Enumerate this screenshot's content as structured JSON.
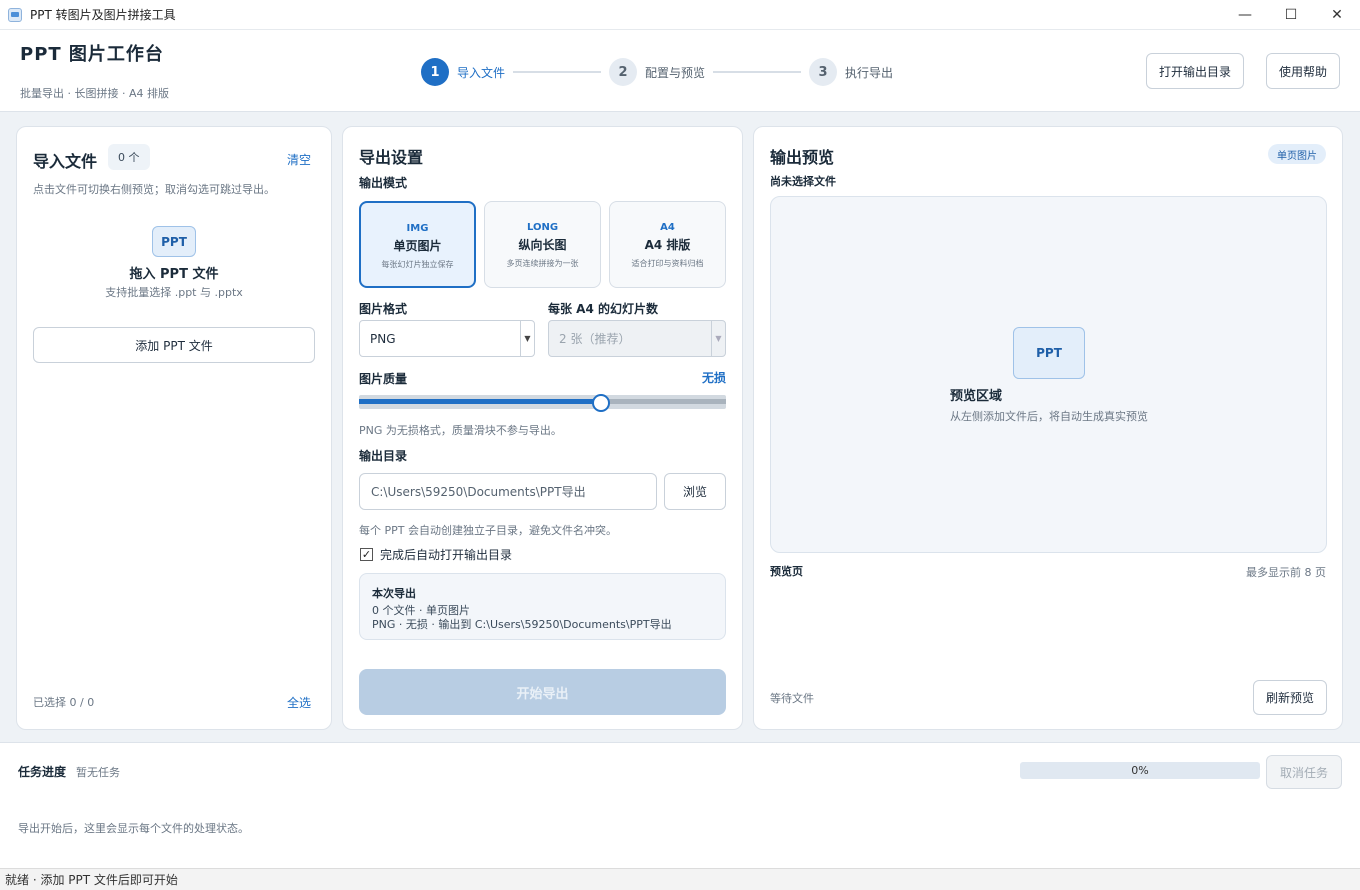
{
  "window": {
    "title": "PPT 转图片及图片拼接工具",
    "minimize": "—",
    "maximize": "☐",
    "close": "✕"
  },
  "header": {
    "title": "PPT 图片工作台",
    "subtitle": "批量导出 · 长图拼接 · A4 排版",
    "steps": [
      {
        "num": "1",
        "label": "导入文件",
        "active": true
      },
      {
        "num": "2",
        "label": "配置与预览",
        "active": false
      },
      {
        "num": "3",
        "label": "执行导出",
        "active": false
      }
    ],
    "open_output_dir": "打开输出目录",
    "help": "使用帮助"
  },
  "import_panel": {
    "title": "导入文件",
    "count_badge": "0 个",
    "clear": "清空",
    "hint": "点击文件可切换右侧预览；取消勾选可跳过导出。",
    "drop_chip": "PPT",
    "drop_title": "拖入 PPT 文件",
    "drop_sub": "支持批量选择 .ppt 与 .pptx",
    "add_button": "添加 PPT 文件",
    "selected_info": "已选择 0 / 0",
    "select_all": "全选"
  },
  "export_settings": {
    "title": "导出设置",
    "mode_label": "输出模式",
    "modes": [
      {
        "tag": "IMG",
        "name": "单页图片",
        "desc": "每张幻灯片独立保存",
        "selected": true
      },
      {
        "tag": "LONG",
        "name": "纵向长图",
        "desc": "多页连续拼接为一张",
        "selected": false
      },
      {
        "tag": "A4",
        "name": "A4 排版",
        "desc": "适合打印与资料归档",
        "selected": false
      }
    ],
    "format_label": "图片格式",
    "format_value": "PNG",
    "per_a4_label": "每张 A4 的幻灯片数",
    "per_a4_value": "2 张（推荐）",
    "quality_label": "图片质量",
    "quality_value": "无损",
    "quality_level": 0.66,
    "quality_note": "PNG 为无损格式，质量滑块不参与导出。",
    "output_dir_label": "输出目录",
    "output_dir_value": "C:\\Users\\59250\\Documents\\PPT导出",
    "browse": "浏览",
    "output_dir_note": "每个 PPT 会自动创建独立子目录，避免文件名冲突。",
    "auto_open_checked": "✓",
    "auto_open_label": "完成后自动打开输出目录",
    "summary_title": "本次导出",
    "summary_line1": "0 个文件 · 单页图片",
    "summary_line2": "PNG · 无损 · 输出到 C:\\Users\\59250\\Documents\\PPT导出",
    "start_button": "开始导出"
  },
  "preview_panel": {
    "title": "输出预览",
    "mode_pill": "单页图片",
    "file_status": "尚未选择文件",
    "chip": "PPT",
    "area_title": "预览区域",
    "area_sub": "从左侧添加文件后，将自动生成真实预览",
    "pages_label": "预览页",
    "pages_limit": "最多显示前 8 页",
    "waiting": "等待文件",
    "refresh": "刷新预览"
  },
  "task": {
    "title": "任务进度",
    "status": "暂无任务",
    "progress_text": "0%",
    "progress_value": 0,
    "cancel": "取消任务",
    "note": "导出开始后，这里会显示每个文件的处理状态。"
  },
  "statusbar": {
    "text": "就绪 · 添加 PPT 文件后即可开始"
  },
  "colors": {
    "accent": "#1f6fc5",
    "disabled_button": "#b8cde3",
    "chip_bg": "#e3eefa"
  }
}
